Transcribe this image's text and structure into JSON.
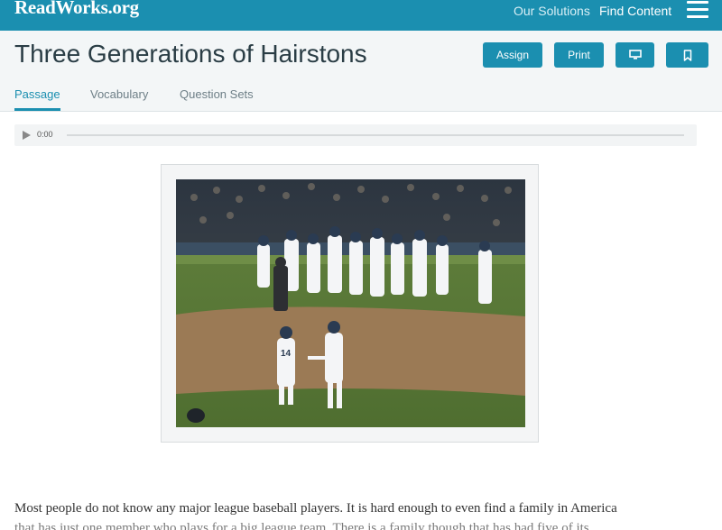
{
  "header": {
    "logo": "ReadWorks.org",
    "nav": [
      "Our Solutions",
      "Find Content"
    ],
    "menu_icon": "hamburger-menu-icon"
  },
  "article": {
    "title": "Three Generations of Hairstons",
    "actions": {
      "assign": "Assign",
      "print": "Print",
      "projector_icon": "monitor-icon",
      "bookmark_icon": "bookmark-icon"
    },
    "tabs": [
      "Passage",
      "Vocabulary",
      "Question Sets"
    ],
    "active_tab": "Passage"
  },
  "audio": {
    "time": "0:00",
    "play_icon": "play-icon"
  },
  "passage": {
    "line1": "Most people do not know any major league baseball players. It is hard enough to even find a family in America",
    "line2": "that has just one member who plays for a big league team. There is a family though that has had five of its"
  },
  "colors": {
    "brand": "#1b8fb0",
    "title_bg": "#f3f6f7"
  }
}
